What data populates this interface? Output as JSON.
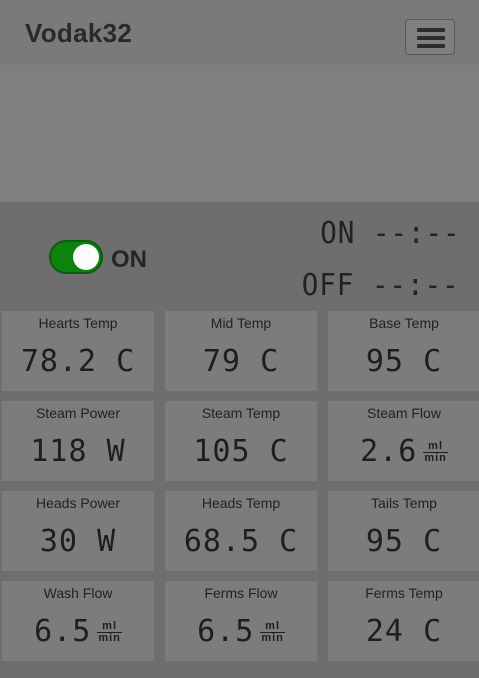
{
  "navbar": {
    "brand": "Vodak32",
    "menu_icon": "hamburger-menu-icon"
  },
  "control": {
    "toggle_state": "ON",
    "schedule_on_label": "ON",
    "schedule_on_time": "--:--",
    "schedule_off_label": "OFF",
    "schedule_off_time": "--:--"
  },
  "sensors": [
    {
      "label": "Hearts Temp",
      "value": "78.2",
      "unit": "C"
    },
    {
      "label": "Mid Temp",
      "value": "79",
      "unit": "C"
    },
    {
      "label": "Base Temp",
      "value": "95",
      "unit": "C"
    },
    {
      "label": "Steam Power",
      "value": "118",
      "unit": "W"
    },
    {
      "label": "Steam Temp",
      "value": "105",
      "unit": "C"
    },
    {
      "label": "Steam Flow",
      "value": "2.6",
      "unit_num": "ml",
      "unit_den": "min"
    },
    {
      "label": "Heads Power",
      "value": "30",
      "unit": "W"
    },
    {
      "label": "Heads Temp",
      "value": "68.5",
      "unit": "C"
    },
    {
      "label": "Tails Temp",
      "value": "95",
      "unit": "C"
    },
    {
      "label": "Wash Flow",
      "value": "6.5",
      "unit_num": "ml",
      "unit_den": "min"
    },
    {
      "label": "Ferms Flow",
      "value": "6.5",
      "unit_num": "ml",
      "unit_den": "min"
    },
    {
      "label": "Ferms Temp",
      "value": "24",
      "unit": "C"
    }
  ],
  "colors": {
    "background": "#6e6e6e",
    "navbar": "#7a7a7a",
    "card": "#7c7c7c",
    "toggle_on": "#0e820e"
  }
}
